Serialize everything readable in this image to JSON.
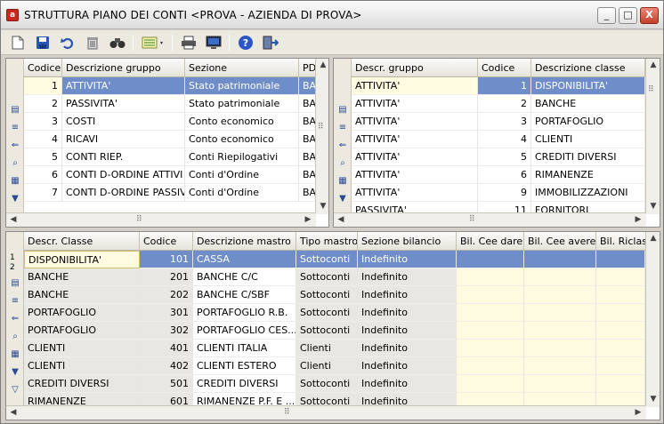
{
  "window": {
    "title": "STRUTTURA PIANO DEI CONTI <PROVA - AZIENDA DI PROVA>",
    "app_icon": "app-icon",
    "buttons": {
      "minimize": "_",
      "maximize": "□",
      "close": "X"
    }
  },
  "toolbar": {
    "icons": [
      "new-icon",
      "save-icon",
      "undo-icon",
      "delete-icon",
      "find-icon",
      "list-view-icon",
      "print-icon",
      "monitor-icon",
      "help-icon",
      "exit-icon"
    ]
  },
  "gruppi": {
    "columns": [
      "Codice",
      "Descrizione gruppo",
      "Sezione",
      "PD"
    ],
    "rows": [
      {
        "codice": "1",
        "descr": "ATTIVITA'",
        "sezione": "Stato patrimoniale",
        "pd": "BAS"
      },
      {
        "codice": "2",
        "descr": "PASSIVITA'",
        "sezione": "Stato patrimoniale",
        "pd": "BAS"
      },
      {
        "codice": "3",
        "descr": "COSTI",
        "sezione": "Conto economico",
        "pd": "BAS"
      },
      {
        "codice": "4",
        "descr": "RICAVI",
        "sezione": "Conto economico",
        "pd": "BAS"
      },
      {
        "codice": "5",
        "descr": "CONTI RIEP.",
        "sezione": "Conti Riepilogativi",
        "pd": "BAS"
      },
      {
        "codice": "6",
        "descr": "CONTI D-ORDINE ATTIVI",
        "sezione": "Conti d'Ordine",
        "pd": "BAS"
      },
      {
        "codice": "7",
        "descr": "CONTI D-ORDINE PASSIVI",
        "sezione": "Conti d'Ordine",
        "pd": "BAS"
      }
    ]
  },
  "classi": {
    "columns": [
      "Descr. gruppo",
      "Codice",
      "Descrizione classe"
    ],
    "rows": [
      {
        "gruppo": "ATTIVITA'",
        "codice": "1",
        "descr": "DISPONIBILITA'"
      },
      {
        "gruppo": "ATTIVITA'",
        "codice": "2",
        "descr": "BANCHE"
      },
      {
        "gruppo": "ATTIVITA'",
        "codice": "3",
        "descr": "PORTAFOGLIO"
      },
      {
        "gruppo": "ATTIVITA'",
        "codice": "4",
        "descr": "CLIENTI"
      },
      {
        "gruppo": "ATTIVITA'",
        "codice": "5",
        "descr": "CREDITI DIVERSI"
      },
      {
        "gruppo": "ATTIVITA'",
        "codice": "6",
        "descr": "RIMANENZE"
      },
      {
        "gruppo": "ATTIVITA'",
        "codice": "9",
        "descr": "IMMOBILIZZAZIONI"
      },
      {
        "gruppo": "PASSIVITA'",
        "codice": "11",
        "descr": "FORNITORI"
      }
    ]
  },
  "mastri": {
    "gutter_labels": [
      "1",
      "2"
    ],
    "columns": [
      "Descr. Classe",
      "Codice",
      "Descrizione mastro",
      "Tipo mastro",
      "Sezione bilancio",
      "Bil. Cee dare",
      "Bil. Cee avere",
      "Bil. Riclass"
    ],
    "rows": [
      {
        "classe": "DISPONIBILITA'",
        "codice": "101",
        "descr": "CASSA",
        "tipo": "Sottoconti",
        "sezione": "Indefinito"
      },
      {
        "classe": "BANCHE",
        "codice": "201",
        "descr": "BANCHE C/C",
        "tipo": "Sottoconti",
        "sezione": "Indefinito"
      },
      {
        "classe": "BANCHE",
        "codice": "202",
        "descr": "BANCHE C/SBF",
        "tipo": "Sottoconti",
        "sezione": "Indefinito"
      },
      {
        "classe": "PORTAFOGLIO",
        "codice": "301",
        "descr": "PORTAFOGLIO R.B.",
        "tipo": "Sottoconti",
        "sezione": "Indefinito"
      },
      {
        "classe": "PORTAFOGLIO",
        "codice": "302",
        "descr": "PORTAFOGLIO CES...",
        "tipo": "Sottoconti",
        "sezione": "Indefinito"
      },
      {
        "classe": "CLIENTI",
        "codice": "401",
        "descr": "CLIENTI ITALIA",
        "tipo": "Clienti",
        "sezione": "Indefinito"
      },
      {
        "classe": "CLIENTI",
        "codice": "402",
        "descr": "CLIENTI ESTERO",
        "tipo": "Clienti",
        "sezione": "Indefinito"
      },
      {
        "classe": "CREDITI DIVERSI",
        "codice": "501",
        "descr": "CREDITI DIVERSI",
        "tipo": "Sottoconti",
        "sezione": "Indefinito"
      },
      {
        "classe": "RIMANENZE",
        "codice": "601",
        "descr": "RIMANENZE P.F. E ...",
        "tipo": "Sottoconti",
        "sezione": "Indefinito"
      }
    ]
  },
  "colors": {
    "selection": "#6f8dc8",
    "highlight": "#fffbe0",
    "grid_bg": "#e9e7e1"
  }
}
